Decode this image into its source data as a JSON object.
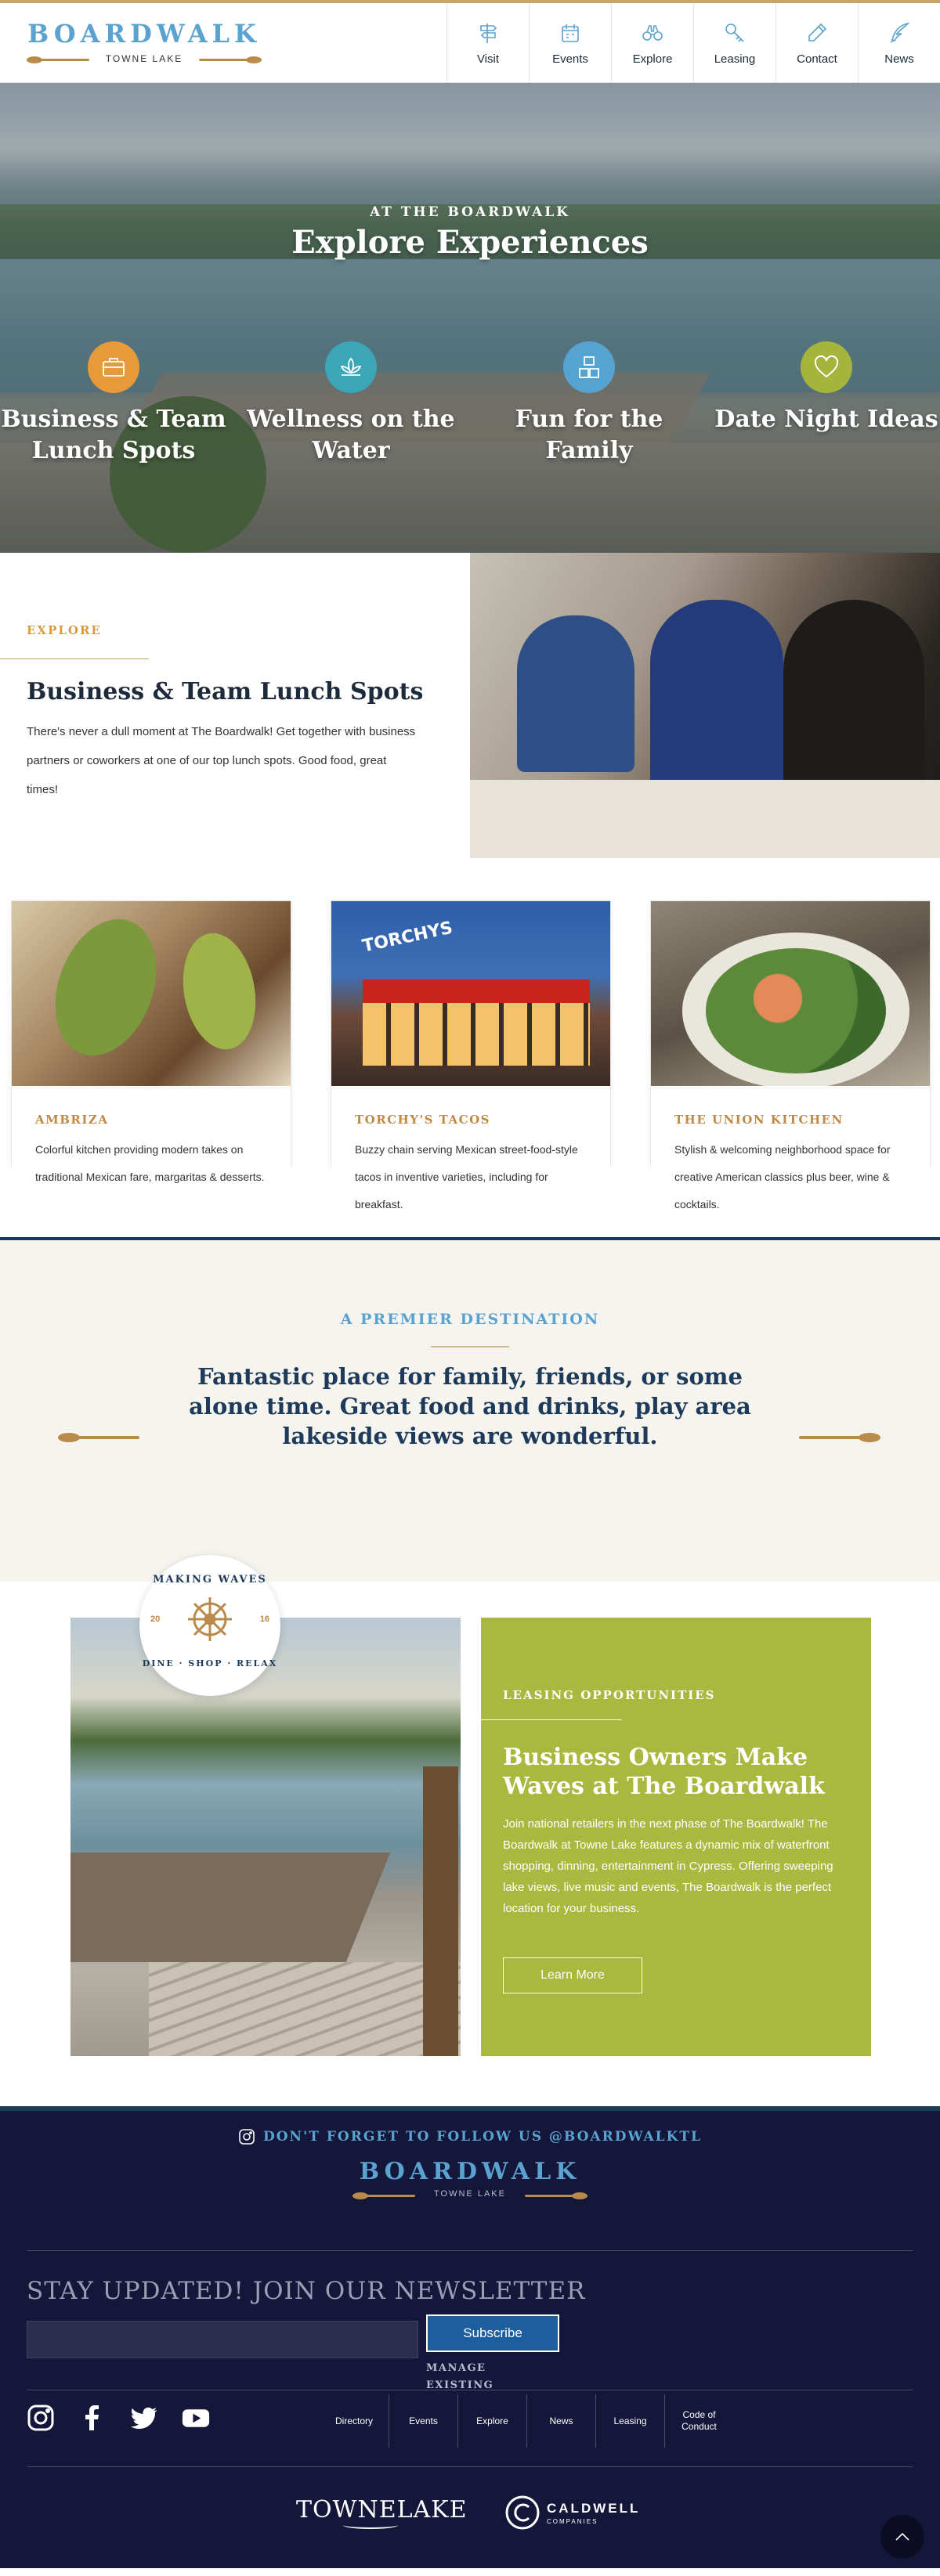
{
  "header": {
    "logo_text": "BOARDWALK",
    "logo_sub": "TOWNE LAKE",
    "nav": [
      {
        "label": "Visit",
        "icon": "signpost-icon"
      },
      {
        "label": "Events",
        "icon": "calendar-icon"
      },
      {
        "label": "Explore",
        "icon": "binoculars-icon"
      },
      {
        "label": "Leasing",
        "icon": "key-icon"
      },
      {
        "label": "Contact",
        "icon": "pencil-icon"
      },
      {
        "label": "News",
        "icon": "quill-icon"
      }
    ]
  },
  "hero": {
    "pre_title": "AT THE BOARDWALK",
    "title": "Explore Experiences",
    "experiences": [
      {
        "label": "Business & Team Lunch Spots",
        "icon": "briefcase-icon",
        "color": "#e79a3a"
      },
      {
        "label": "Wellness on the Water",
        "icon": "lotus-icon",
        "color": "#3aa6b8"
      },
      {
        "label": "Fun for the Family",
        "icon": "family-icon",
        "color": "#55a3d1"
      },
      {
        "label": "Date Night Ideas",
        "icon": "heart-icon",
        "color": "#a5b43a"
      }
    ]
  },
  "feature": {
    "eyebrow": "EXPLORE",
    "title": "Business & Team Lunch Spots",
    "text": "There's never a dull moment at The Boardwalk! Get together with business partners or coworkers at one of our top lunch spots. Good food, great times!"
  },
  "cards": [
    {
      "title": "AMBRIZA",
      "text": "Colorful kitchen providing modern takes on traditional Mexican fare, margaritas & desserts."
    },
    {
      "title": "TORCHY'S TACOS",
      "text": "Buzzy chain serving Mexican street-food-style tacos in inventive varieties, including for breakfast.",
      "sign": "TORCHYS"
    },
    {
      "title": "THE UNION KITCHEN",
      "text": "Stylish & welcoming neighborhood space for creative American classics plus beer, wine & cocktails."
    }
  ],
  "quote": {
    "eyebrow": "A PREMIER DESTINATION",
    "text": "Fantastic place for family, friends, or some alone time. Great food and drinks, play area lakeside views are wonderful."
  },
  "leasing": {
    "badge_top": "MAKING WAVES",
    "badge_bottom": "DINE · SHOP · RELAX",
    "badge_year_left": "20",
    "badge_year_right": "16",
    "eyebrow": "LEASING OPPORTUNITIES",
    "title": "Business Owners Make Waves at The Boardwalk",
    "text": "Join national retailers in the next phase of The Boardwalk! The Boardwalk at Towne Lake features a dynamic mix of waterfront shopping, dinning, entertainment in Cypress. Offering sweeping lake views, live music and events, The Boardwalk is the perfect location for your business.",
    "button": "Learn More"
  },
  "footer": {
    "follow": "DON'T FORGET TO FOLLOW US @BOARDWALKTL",
    "logo_text": "BOARDWALK",
    "logo_sub": "TOWNE LAKE",
    "newsletter_title": "STAY UPDATED! JOIN OUR NEWSLETTER",
    "newsletter_placeholder": "",
    "subscribe": "Subscribe",
    "manage": "MANAGE EXISTING",
    "nav": [
      "Directory",
      "Events",
      "Explore",
      "News",
      "Leasing",
      "Code of Conduct"
    ],
    "partner1": "TOWNELAKE",
    "partner2_name": "CALDWELL",
    "partner2_sub": "COMPANIES"
  }
}
